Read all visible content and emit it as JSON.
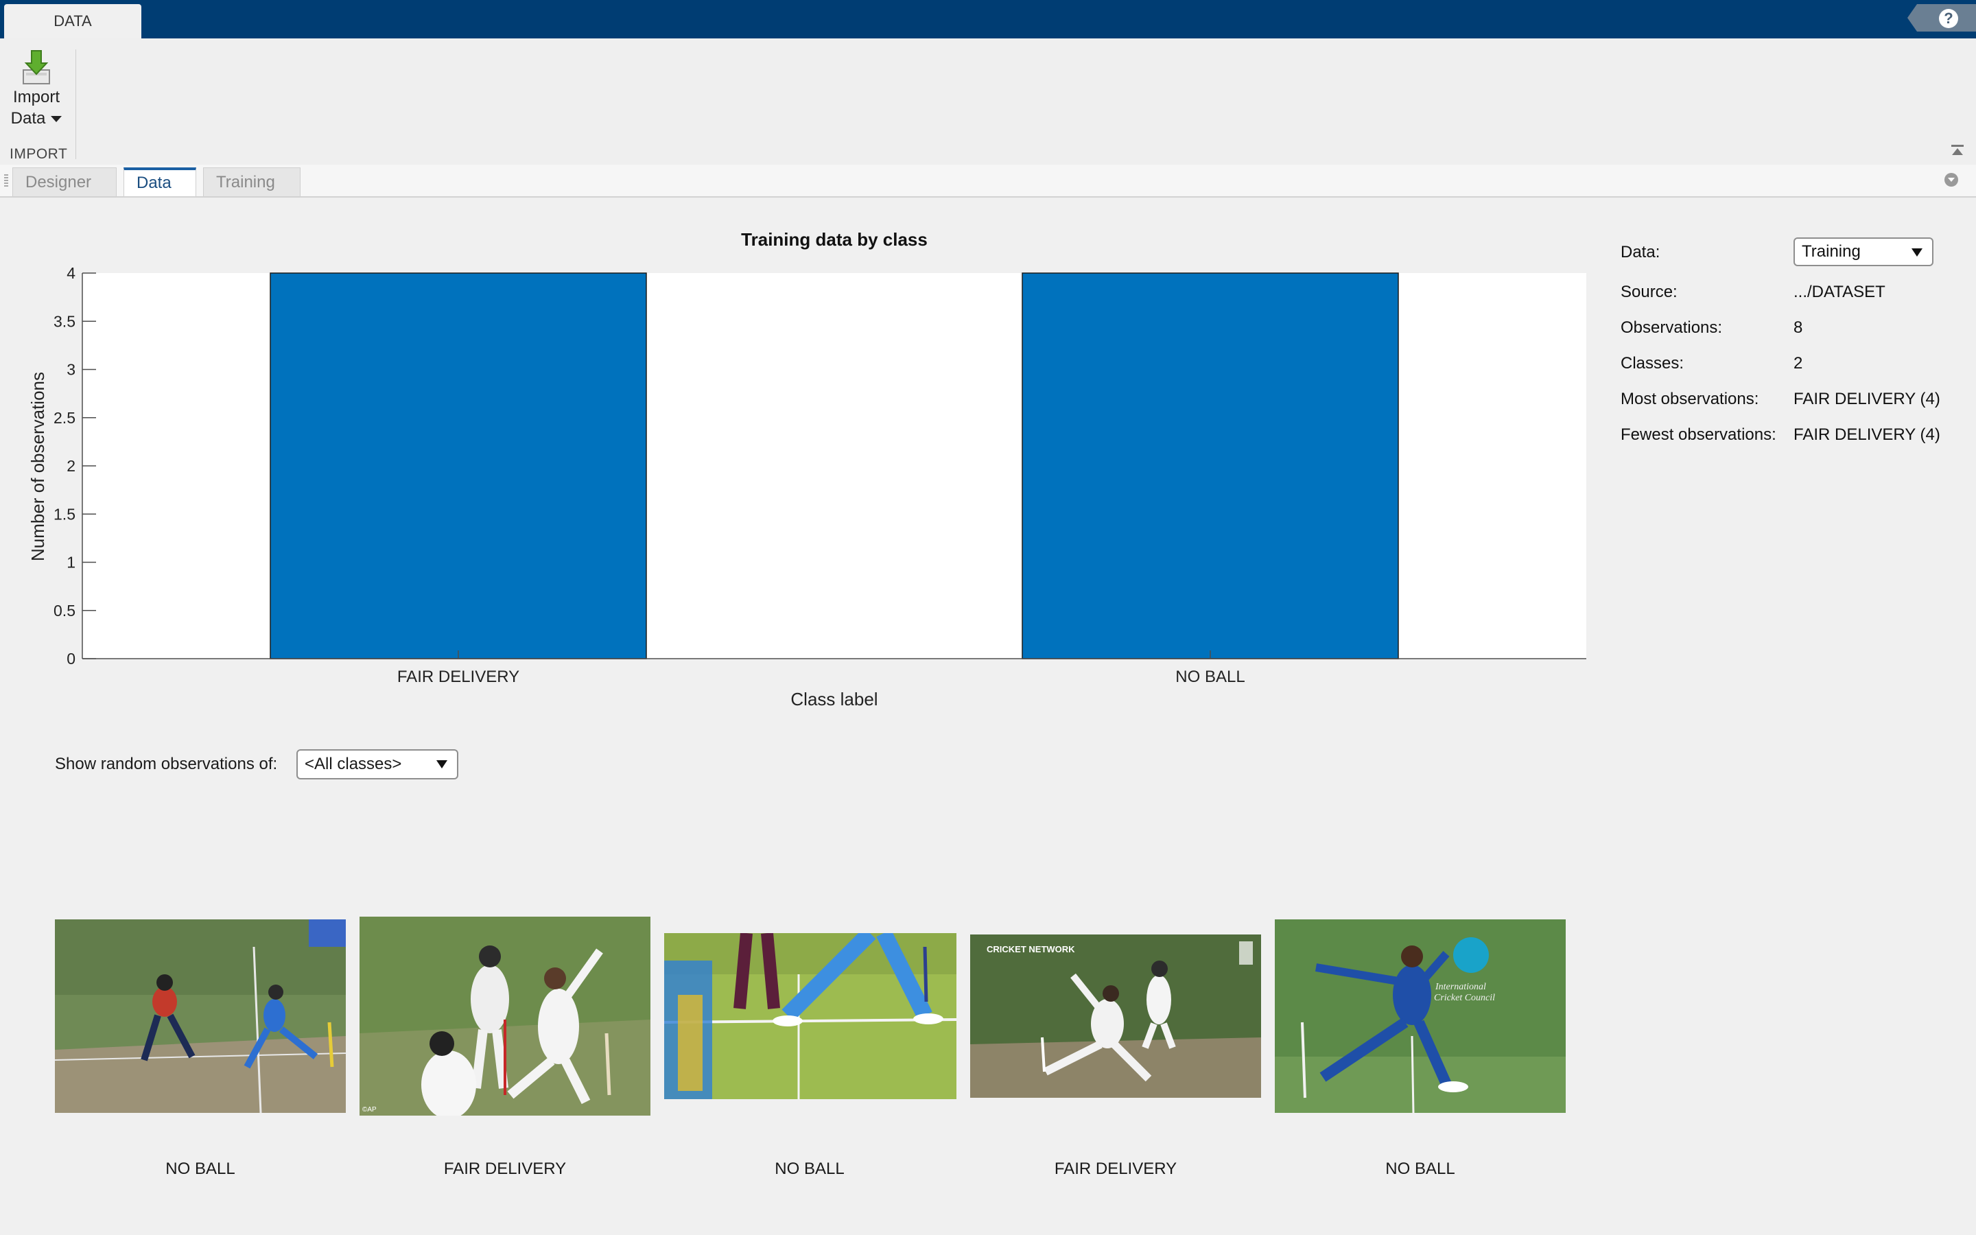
{
  "toolstrip": {
    "tab_label": "DATA",
    "import_label_line1": "Import",
    "import_label_line2": "Data",
    "section_label": "IMPORT",
    "help_label": "?"
  },
  "doc_tabs": [
    {
      "label": "Designer",
      "active": false
    },
    {
      "label": "Data",
      "active": true
    },
    {
      "label": "Training",
      "active": false
    }
  ],
  "chart_data": {
    "type": "bar",
    "title": "Training data by class",
    "xlabel": "Class label",
    "ylabel": "Number of observations",
    "categories": [
      "FAIR DELIVERY",
      "NO BALL"
    ],
    "values": [
      4,
      4
    ],
    "ylim": [
      0,
      4
    ],
    "yticks": [
      0,
      0.5,
      1,
      1.5,
      2,
      2.5,
      3,
      3.5,
      4
    ],
    "bar_color": "#0072bd",
    "grid": false
  },
  "info": {
    "data_label": "Data:",
    "data_value": "Training",
    "source_label": "Source:",
    "source_value": ".../DATASET",
    "observations_label": "Observations:",
    "observations_value": "8",
    "classes_label": "Classes:",
    "classes_value": "2",
    "most_label": "Most observations:",
    "most_value": "FAIR DELIVERY (4)",
    "fewest_label": "Fewest observations:",
    "fewest_value": "FAIR DELIVERY (4)"
  },
  "observations": {
    "label": "Show random observations of:",
    "selected_class": "<All classes>",
    "images": [
      {
        "caption": "NO BALL",
        "image": "cricket-bowler-photo"
      },
      {
        "caption": "FAIR DELIVERY",
        "image": "cricket-bowler-photo"
      },
      {
        "caption": "NO BALL",
        "image": "cricket-crease-photo"
      },
      {
        "caption": "FAIR DELIVERY",
        "image": "cricket-bowler-photo"
      },
      {
        "caption": "NO BALL",
        "image": "cricket-bowler-photo"
      }
    ],
    "overlay_texts": {
      "network_logo": "CRICKET NETWORK",
      "icc_line1": "International",
      "icc_line2": "Cricket Council",
      "ap_mark": "©AP"
    }
  },
  "colors": {
    "titlebar": "#003d73",
    "bar": "#0072bd",
    "active_tab": "#1a5fa3"
  }
}
